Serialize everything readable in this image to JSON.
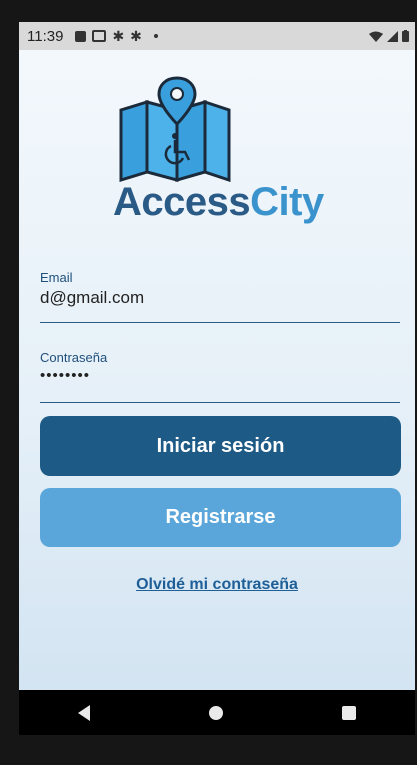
{
  "status_bar": {
    "time": "11:39",
    "icons": [
      "notification-box-icon",
      "image-icon",
      "gear-icon",
      "gear-icon",
      "dot-icon",
      "wifi-icon",
      "signal-icon",
      "battery-icon"
    ]
  },
  "brand": {
    "part1": "Access",
    "part2": "City",
    "colors": {
      "primary": "#2a5a86",
      "accent": "#3a93cc"
    }
  },
  "form": {
    "email_label": "Email",
    "email_value": "d@gmail.com",
    "password_label": "Contraseña",
    "password_value": "••••••••"
  },
  "buttons": {
    "login": "Iniciar sesión",
    "register": "Registrarse",
    "forgot": "Olvidé mi contraseña"
  },
  "colors": {
    "login_button": "#1d5a86",
    "register_button": "#5aa6da",
    "link": "#1e5f98"
  }
}
